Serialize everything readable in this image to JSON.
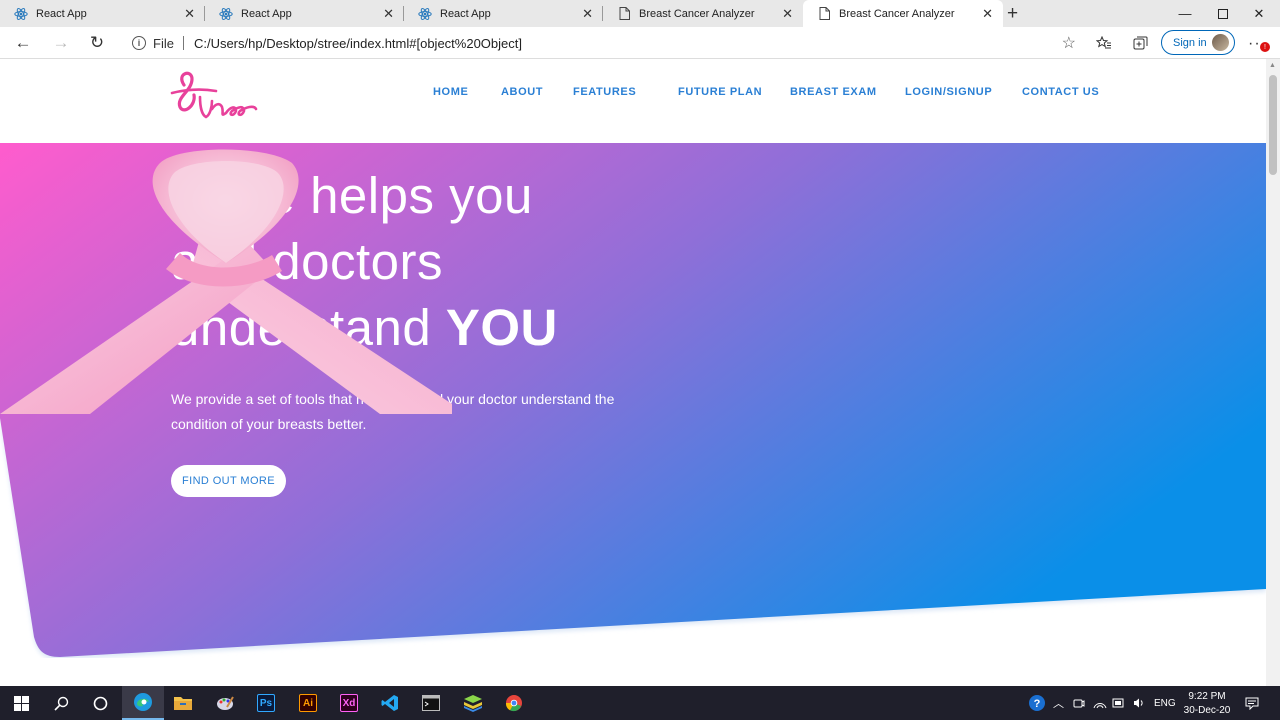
{
  "browser": {
    "tabs": [
      {
        "title": "React App",
        "icon": "react-icon"
      },
      {
        "title": "React App",
        "icon": "react-icon"
      },
      {
        "title": "React App",
        "icon": "react-icon"
      },
      {
        "title": "Breast Cancer Analyzer",
        "icon": "page-icon"
      },
      {
        "title": "Breast Cancer Analyzer",
        "icon": "page-icon",
        "active": true
      }
    ],
    "close_glyph": "✕",
    "address": {
      "scheme_label": "File",
      "url": "C:/Users/hp/Desktop/stree/index.html#[object%20Object]"
    },
    "signin_label": "Sign in"
  },
  "site": {
    "nav": [
      "HOME",
      "ABOUT",
      "FEATURES",
      "FUTURE PLAN",
      "BREAST EXAM",
      "LOGIN/SIGNUP",
      "CONTACT US"
    ],
    "hero": {
      "title_line1": "Stree helps you",
      "title_line2": "and doctors",
      "title_line3_prefix": "understand ",
      "title_line3_bold": "YOU",
      "description": "We provide a set of tools that helps you and your doctor understand the condition of your breasts better.",
      "cta_label": "FIND OUT MORE"
    },
    "colors": {
      "accent": "#2a7fd4",
      "gradient_start": "#ff5ccd",
      "gradient_mid": "#8f6fd8",
      "gradient_end": "#0a8fe8",
      "ribbon": "#f7b7d3"
    }
  },
  "taskbar": {
    "tray_lang": "ENG",
    "time": "9:22 PM",
    "date": "30-Dec-20"
  }
}
